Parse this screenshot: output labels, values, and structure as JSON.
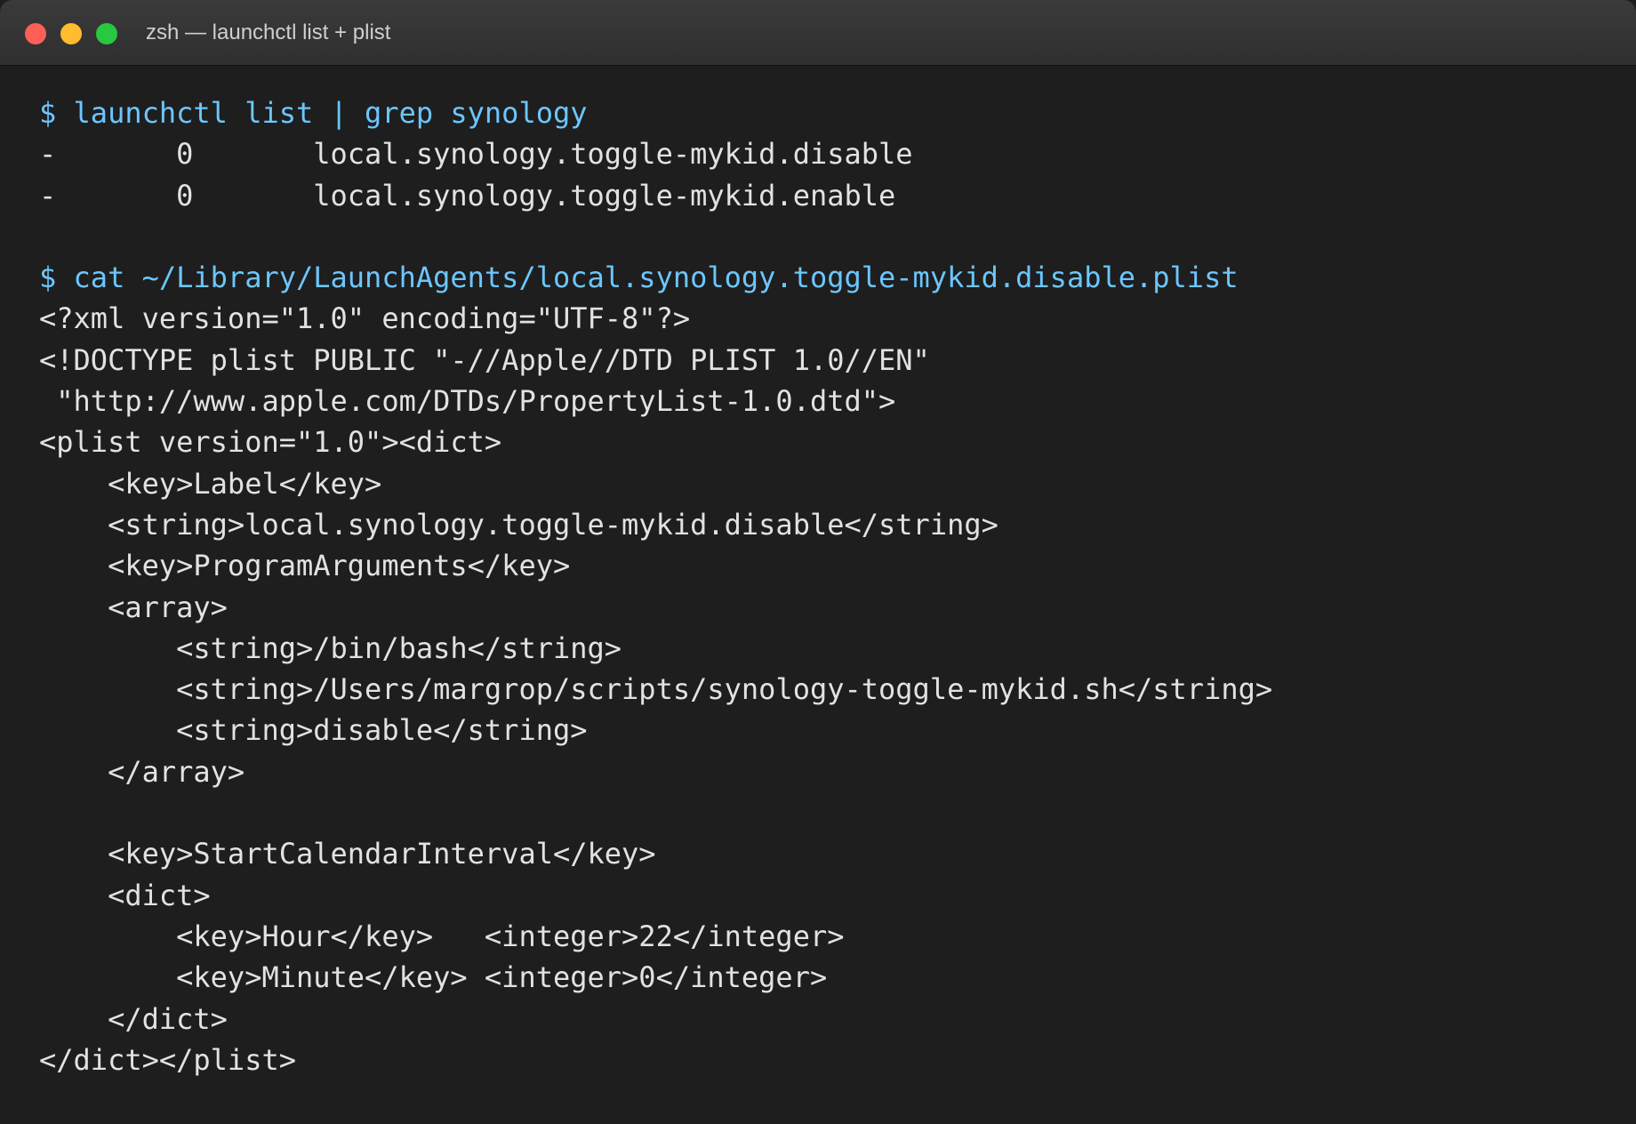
{
  "window": {
    "title": "zsh — launchctl list + plist",
    "colors": {
      "background": "#1e1e1e",
      "command": "#6cc6ff",
      "output": "#e2e2e2",
      "close": "#fe5f57",
      "minimize": "#febc2e",
      "zoom": "#28c840"
    }
  },
  "terminal": {
    "lines": [
      {
        "text": "$ launchctl list | grep synology",
        "kind": "command"
      },
      {
        "text": "-       0       local.synology.toggle-mykid.disable",
        "kind": "output"
      },
      {
        "text": "-       0       local.synology.toggle-mykid.enable",
        "kind": "output"
      },
      {
        "text": "",
        "kind": "blank"
      },
      {
        "text": "$ cat ~/Library/LaunchAgents/local.synology.toggle-mykid.disable.plist",
        "kind": "command"
      },
      {
        "text": "<?xml version=\"1.0\" encoding=\"UTF-8\"?>",
        "kind": "output"
      },
      {
        "text": "<!DOCTYPE plist PUBLIC \"-//Apple//DTD PLIST 1.0//EN\"",
        "kind": "output"
      },
      {
        "text": " \"http://www.apple.com/DTDs/PropertyList-1.0.dtd\">",
        "kind": "output"
      },
      {
        "text": "<plist version=\"1.0\"><dict>",
        "kind": "output"
      },
      {
        "text": "    <key>Label</key>",
        "kind": "output"
      },
      {
        "text": "    <string>local.synology.toggle-mykid.disable</string>",
        "kind": "output"
      },
      {
        "text": "    <key>ProgramArguments</key>",
        "kind": "output"
      },
      {
        "text": "    <array>",
        "kind": "output"
      },
      {
        "text": "        <string>/bin/bash</string>",
        "kind": "output"
      },
      {
        "text": "        <string>/Users/margrop/scripts/synology-toggle-mykid.sh</string>",
        "kind": "output"
      },
      {
        "text": "        <string>disable</string>",
        "kind": "output"
      },
      {
        "text": "    </array>",
        "kind": "output"
      },
      {
        "text": "",
        "kind": "blank"
      },
      {
        "text": "    <key>StartCalendarInterval</key>",
        "kind": "output"
      },
      {
        "text": "    <dict>",
        "kind": "output"
      },
      {
        "text": "        <key>Hour</key>   <integer>22</integer>",
        "kind": "output"
      },
      {
        "text": "        <key>Minute</key> <integer>0</integer>",
        "kind": "output"
      },
      {
        "text": "    </dict>",
        "kind": "output"
      },
      {
        "text": "</dict></plist>",
        "kind": "output"
      }
    ]
  }
}
